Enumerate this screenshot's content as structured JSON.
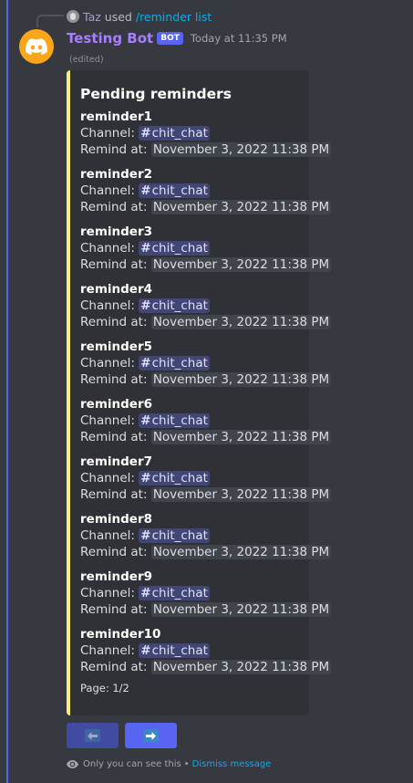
{
  "reply": {
    "user": "Taz",
    "used_text": "used",
    "command": "/reminder list"
  },
  "message": {
    "author": "Testing Bot",
    "bot_tag": "BOT",
    "timestamp": "Today at 11:35 PM",
    "edited": "(edited)"
  },
  "embed": {
    "accent_color": "#f8f277",
    "title": "Pending reminders",
    "channel_label": "Channel:",
    "remind_label": "Remind at:",
    "fields": [
      {
        "name": "reminder1",
        "channel": "chit_chat",
        "remind_at": "November 3, 2022 11:38 PM"
      },
      {
        "name": "reminder2",
        "channel": "chit_chat",
        "remind_at": "November 3, 2022 11:38 PM"
      },
      {
        "name": "reminder3",
        "channel": "chit_chat",
        "remind_at": "November 3, 2022 11:38 PM"
      },
      {
        "name": "reminder4",
        "channel": "chit_chat",
        "remind_at": "November 3, 2022 11:38 PM"
      },
      {
        "name": "reminder5",
        "channel": "chit_chat",
        "remind_at": "November 3, 2022 11:38 PM"
      },
      {
        "name": "reminder6",
        "channel": "chit_chat",
        "remind_at": "November 3, 2022 11:38 PM"
      },
      {
        "name": "reminder7",
        "channel": "chit_chat",
        "remind_at": "November 3, 2022 11:38 PM"
      },
      {
        "name": "reminder8",
        "channel": "chit_chat",
        "remind_at": "November 3, 2022 11:38 PM"
      },
      {
        "name": "reminder9",
        "channel": "chit_chat",
        "remind_at": "November 3, 2022 11:38 PM"
      },
      {
        "name": "reminder10",
        "channel": "chit_chat",
        "remind_at": "November 3, 2022 11:38 PM"
      }
    ],
    "footer": "Page: 1/2"
  },
  "buttons": {
    "prev_icon": "arrow-left-icon",
    "next_icon": "arrow-right-icon"
  },
  "ephemeral": {
    "notice": "Only you can see this",
    "separator": "•",
    "dismiss": "Dismiss message"
  },
  "colors": {
    "background": "#36393f",
    "embed_bg": "#2f3136",
    "bot_name": "#a67fff",
    "blurple": "#5865f2",
    "link": "#00aff4"
  }
}
